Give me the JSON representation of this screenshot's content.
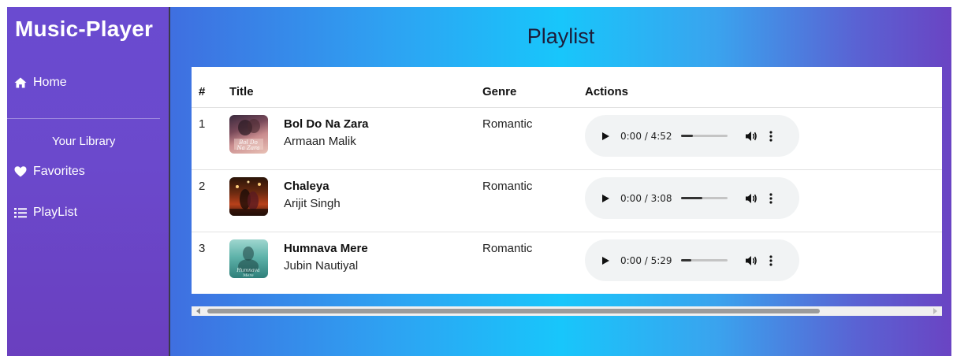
{
  "sidebar": {
    "brand": "Music-Player",
    "home_label": "Home",
    "library_label": "Your Library",
    "favorites_label": "Favorites",
    "playlist_label": "PlayList"
  },
  "main": {
    "title": "Playlist",
    "columns": [
      "#",
      "Title",
      "Genre",
      "Actions"
    ],
    "rows": [
      {
        "num": "1",
        "title": "Bol Do Na Zara",
        "artist": "Armaan Malik",
        "genre": "Romantic",
        "time": "0:00 / 4:52",
        "progress": 0.25,
        "cover_text": "Bol Do Na Zara"
      },
      {
        "num": "2",
        "title": "Chaleya",
        "artist": "Arijit Singh",
        "genre": "Romantic",
        "time": "0:00 / 3:08",
        "progress": 0.45,
        "cover_text": ""
      },
      {
        "num": "3",
        "title": "Humnava Mere",
        "artist": "Jubin Nautiyal",
        "genre": "Romantic",
        "time": "0:00 / 5:29",
        "progress": 0.22,
        "cover_text": "Humnava Mere"
      }
    ]
  },
  "colors": {
    "sidebar": "#6a4bd0",
    "main_center": "#18c6fb",
    "player_bg": "#f1f3f4"
  }
}
